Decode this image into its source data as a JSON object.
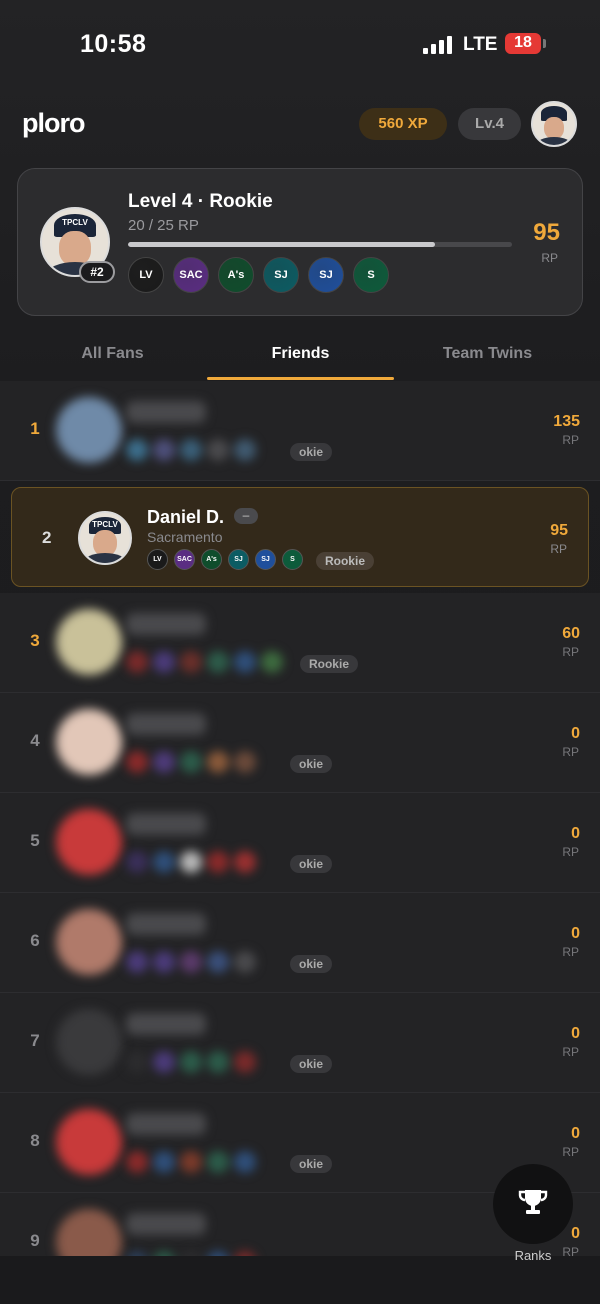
{
  "status_bar": {
    "time": "10:58",
    "network": "LTE",
    "battery": "18"
  },
  "header": {
    "logo": "ploro",
    "xp": "560 XP",
    "level_badge": "Lv.4"
  },
  "profile_card": {
    "title": "Level 4 · Rookie",
    "progress_text": "20 / 25 RP",
    "progress_fraction": 0.8,
    "rank_badge": "#2",
    "points": "95",
    "points_unit": "RP",
    "cap_text": "TPCLV",
    "teams": [
      {
        "icon": "raiders-logo",
        "abbr": "LV",
        "color": "#1a1a1a"
      },
      {
        "icon": "kings-logo",
        "abbr": "SAC",
        "color": "#5a2d82"
      },
      {
        "icon": "athletics-logo",
        "abbr": "A's",
        "color": "#0f4d2c"
      },
      {
        "icon": "sharks-logo",
        "abbr": "SJ",
        "color": "#0c5c63"
      },
      {
        "icon": "earthquakes-logo",
        "abbr": "SJ",
        "color": "#1f4f9c"
      },
      {
        "icon": "sacramento-state-logo",
        "abbr": "S",
        "color": "#0d5b3b"
      }
    ]
  },
  "tabs": [
    {
      "label": "All Fans"
    },
    {
      "label": "Friends"
    },
    {
      "label": "Team Twins"
    }
  ],
  "leaderboard": [
    {
      "rank": "1",
      "points": "135",
      "unit": "RP",
      "pill": "okie",
      "avatar_color": "#6f8aa8",
      "dots": [
        "#3c6e8c",
        "#4d4f7a",
        "#3a5f78",
        "#4a4a4d",
        "#405a70"
      ]
    },
    {
      "rank": "3",
      "points": "60",
      "unit": "RP",
      "pill": "Rookie",
      "avatar_color": "#c9c199",
      "dots": [
        "#7a2a2a",
        "#4b3b7a",
        "#6a2f2a",
        "#2d5c4a",
        "#2f4f7a",
        "#3d6b3f"
      ]
    },
    {
      "rank": "4",
      "points": "0",
      "unit": "RP",
      "pill": "okie",
      "avatar_color": "#e2c7b8",
      "dots": [
        "#8a2a2a",
        "#4e3b7a",
        "#2c5c4a",
        "#8a5a3a",
        "#6b4a3a"
      ]
    },
    {
      "rank": "5",
      "points": "0",
      "unit": "RP",
      "pill": "okie",
      "avatar_color": "#c83a3a",
      "dots": [
        "#3a2f5a",
        "#2f4f7a",
        "#b8b8b8",
        "#8a2a2a",
        "#9a3030"
      ]
    },
    {
      "rank": "6",
      "points": "0",
      "unit": "RP",
      "pill": "okie",
      "avatar_color": "#b07a6a",
      "dots": [
        "#4b3b7a",
        "#4b3b7a",
        "#5a3a6a",
        "#3a4f7a",
        "#4a4a4d"
      ]
    },
    {
      "rank": "7",
      "points": "0",
      "unit": "RP",
      "pill": "okie",
      "avatar_color": "#3a3a3c",
      "dots": [
        "#2c2c2e",
        "#4b3b7a",
        "#2c5c4a",
        "#2c5c4a",
        "#7a2a2a"
      ]
    },
    {
      "rank": "8",
      "points": "0",
      "unit": "RP",
      "pill": "okie",
      "avatar_color": "#c83a3a",
      "dots": [
        "#8a2a2a",
        "#2f4f7a",
        "#7a3a2a",
        "#2c5c4a",
        "#2f4f7a"
      ]
    },
    {
      "rank": "9",
      "points": "0",
      "unit": "RP",
      "pill": "",
      "avatar_color": "#8a5a4a",
      "dots": [
        "#2c3f5a",
        "#2c5c4a",
        "#2c2c2e",
        "#2f4f7a",
        "#7a2a2a"
      ]
    }
  ],
  "self_row": {
    "rank": "2",
    "name": "Daniel D.",
    "badge": "–",
    "location": "Sacramento",
    "pill": "Rookie",
    "points": "95",
    "unit": "RP"
  },
  "fab": {
    "icon": "trophy-icon",
    "label": "Ranks"
  }
}
